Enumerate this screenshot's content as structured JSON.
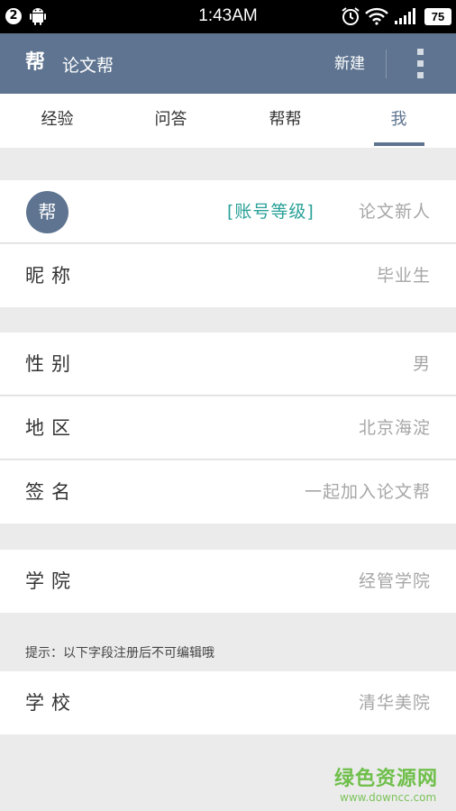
{
  "status_bar": {
    "notification_count": "2",
    "time": "1:43AM",
    "battery": "75",
    "icons": [
      "android-icon",
      "alarm-icon",
      "wifi-icon",
      "signal-icon",
      "battery-icon"
    ]
  },
  "app_bar": {
    "logo_char": "帮",
    "title": "论文帮",
    "new_label": "新建",
    "menu_icon": "more-vertical-icon",
    "color": "#5e7490"
  },
  "tabs": [
    {
      "label": "经验",
      "active": false
    },
    {
      "label": "问答",
      "active": false
    },
    {
      "label": "帮帮",
      "active": false
    },
    {
      "label": "我",
      "active": true
    }
  ],
  "profile": {
    "avatar_char": "帮",
    "level_tag": "[账号等级]",
    "level_value": "论文新人",
    "accent_color": "#2aa198",
    "rows": {
      "nickname": {
        "label": "昵称",
        "value": "毕业生"
      },
      "gender": {
        "label": "性别",
        "value": "男"
      },
      "region": {
        "label": "地区",
        "value": "北京海淀"
      },
      "signature": {
        "label": "签名",
        "value": "一起加入论文帮"
      },
      "college": {
        "label": "学院",
        "value": "经管学院"
      },
      "school": {
        "label": "学校",
        "value": "清华美院"
      }
    }
  },
  "hint": "提示：以下字段注册后不可编辑哦",
  "watermark": {
    "cn": "绿色资源网",
    "en": "www.downcc.com"
  }
}
